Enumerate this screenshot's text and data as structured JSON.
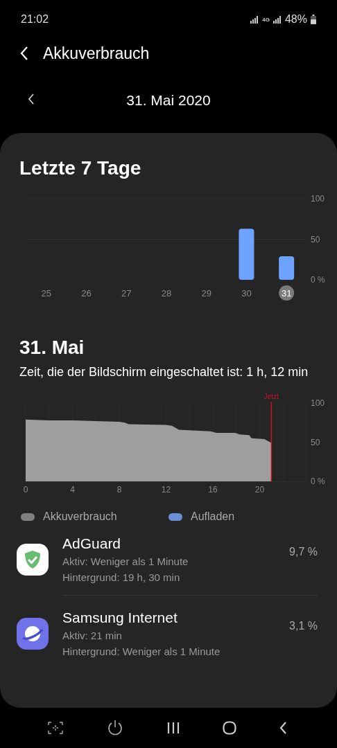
{
  "status_bar": {
    "time": "21:02",
    "network_type": "4G",
    "battery": "48%"
  },
  "header": {
    "title": "Akkuverbrauch"
  },
  "date_nav": {
    "date": "31. Mai 2020"
  },
  "week": {
    "title": "Letzte 7 Tage",
    "chart_data": {
      "type": "bar",
      "categories": [
        "25",
        "26",
        "27",
        "28",
        "29",
        "30",
        "31"
      ],
      "series": [
        {
          "color": "#6ea2ff",
          "values": [
            0,
            0,
            0,
            0,
            0,
            63,
            29
          ]
        }
      ],
      "ylim": [
        0,
        100
      ],
      "yticks": [
        {
          "value": 0,
          "label": "0 %"
        },
        50,
        100
      ],
      "grid": true
    },
    "days": [
      {
        "selected": false
      },
      {
        "selected": false
      },
      {
        "selected": false
      },
      {
        "selected": false
      },
      {
        "selected": false
      },
      {
        "selected": false
      },
      {
        "selected": true
      }
    ]
  },
  "day": {
    "title": "31. Mai",
    "screen_time": "Zeit, die der Bildschirm eingeschaltet ist: 1 h, 12 min",
    "chart_data": {
      "type": "area",
      "x": [
        0,
        2,
        4,
        6,
        8,
        8.5,
        8.8,
        12,
        12.5,
        13.1,
        15.8,
        16.3,
        17.9,
        18.3,
        19.1,
        19.3,
        20.4,
        21
      ],
      "series": [
        {
          "color": "#9e9e9e",
          "values": [
            79,
            78,
            78,
            77,
            76,
            75,
            73,
            72,
            71,
            66,
            64,
            62,
            62,
            60,
            59,
            55,
            54,
            49
          ]
        }
      ],
      "xlim": [
        0,
        24
      ],
      "ylim": [
        0,
        100
      ],
      "xticks": [
        0,
        4,
        8,
        12,
        16,
        20
      ],
      "yticks": [
        {
          "value": 0,
          "label": "0 %"
        },
        50,
        100
      ],
      "grid": true,
      "ref_lines": [
        {
          "axis": "x",
          "value": 21,
          "label": "Jetzt",
          "color": "#c8102e"
        }
      ]
    }
  },
  "legend": [
    {
      "label": "Akkuverbrauch",
      "color": "#808080"
    },
    {
      "label": "Aufladen",
      "color": "#6b8fd6"
    }
  ],
  "apps": [
    {
      "name": "AdGuard",
      "kind": "adguard",
      "active": "Aktiv: Weniger als 1 Minute",
      "background": "Hintergrund: 19 h, 30 min",
      "percent": "9,7 %"
    },
    {
      "name": "Samsung Internet",
      "kind": "browser",
      "active": "Aktiv: 21 min",
      "background": "Hintergrund: Weniger als 1 Minute",
      "percent": "3,1 %"
    }
  ]
}
